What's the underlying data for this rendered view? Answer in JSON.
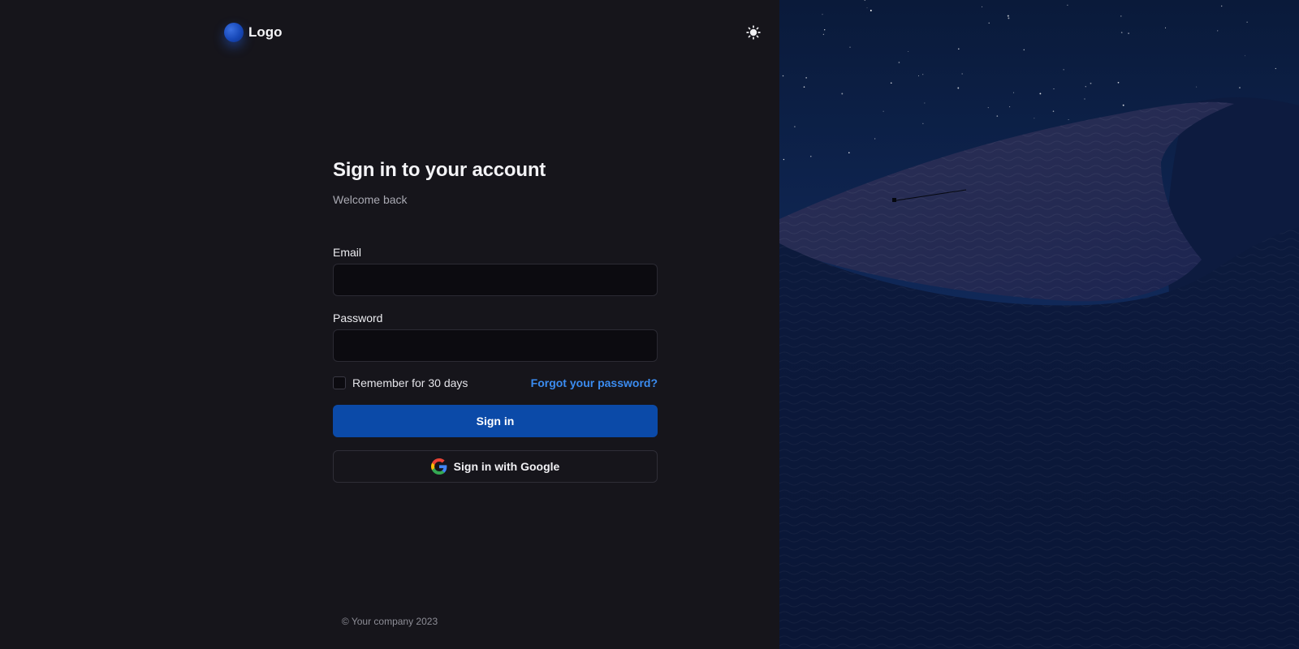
{
  "header": {
    "logo_text": "Logo",
    "theme_toggle_icon": "sun-icon"
  },
  "form": {
    "title": "Sign in to your account",
    "subtitle": "Welcome back",
    "email_label": "Email",
    "email_value": "",
    "password_label": "Password",
    "password_value": "",
    "remember_label": "Remember for 30 days",
    "remember_checked": false,
    "forgot_label": "Forgot your password?",
    "signin_label": "Sign in",
    "google_label": "Sign in with Google"
  },
  "footer": {
    "copyright": "© Your company 2023"
  },
  "colors": {
    "background": "#16151b",
    "input_background": "#0c0b10",
    "primary_button": "#0b4aa8",
    "link": "#3b8cf0",
    "hero_sky": "#0b1630"
  },
  "hero": {
    "icon": "desert-night-dune-image"
  }
}
